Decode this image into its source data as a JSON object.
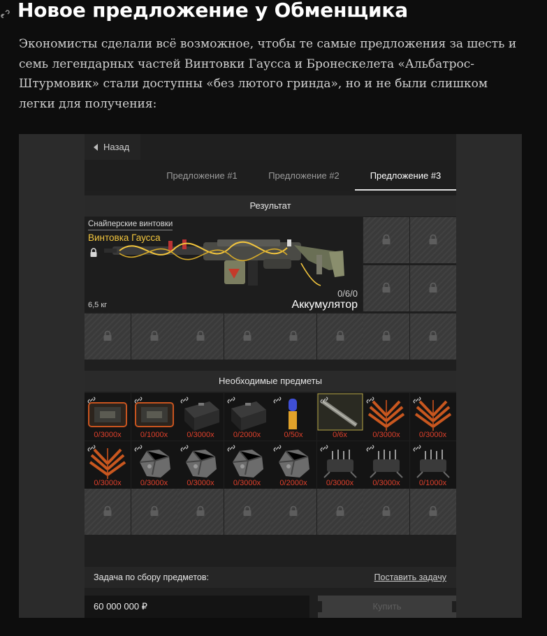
{
  "article": {
    "heading": "Новое предложение у Обменщика",
    "paragraph": "Экономисты сделали всё возможное, чтобы те самые предложения за шесть и семь легендарных частей Винтовки Гаусса и Бронескелета «Альбатрос-Штурмовик» стали доступны «без лютого гринда», но и не были слишком легки для получения:"
  },
  "ui": {
    "back_label": "Назад",
    "tabs": [
      {
        "label": "Предложение #1",
        "active": false
      },
      {
        "label": "Предложение #2",
        "active": false
      },
      {
        "label": "Предложение #3",
        "active": true
      }
    ],
    "result_title": "Результат",
    "weapon": {
      "category": "Снайперские винтовки",
      "name": "Винтовка Гаусса",
      "weight": "6,5 кг",
      "ammo_count": "0/6/0",
      "ammo_type": "Аккумулятор"
    },
    "required_title": "Необходимые предметы",
    "required_items": [
      {
        "qty": "0/3000x",
        "icon": "crate-icon"
      },
      {
        "qty": "0/1000x",
        "icon": "crate-icon"
      },
      {
        "qty": "0/3000x",
        "icon": "battery-icon"
      },
      {
        "qty": "0/2000x",
        "icon": "battery-icon"
      },
      {
        "qty": "0/50x",
        "icon": "cartridge-icon"
      },
      {
        "qty": "0/6x",
        "icon": "rifle-part-icon"
      },
      {
        "qty": "0/3000x",
        "icon": "fern-icon"
      },
      {
        "qty": "0/3000x",
        "icon": "fern-icon"
      },
      {
        "qty": "0/3000x",
        "icon": "fern-icon"
      },
      {
        "qty": "0/3000x",
        "icon": "ore-icon"
      },
      {
        "qty": "0/3000x",
        "icon": "ore-icon"
      },
      {
        "qty": "0/3000x",
        "icon": "ore-icon"
      },
      {
        "qty": "0/2000x",
        "icon": "ore-icon"
      },
      {
        "qty": "0/3000x",
        "icon": "wire-bundle-icon"
      },
      {
        "qty": "0/3000x",
        "icon": "wire-bundle-icon"
      },
      {
        "qty": "0/1000x",
        "icon": "wire-bundle-icon"
      }
    ],
    "task_label": "Задача по сбору предметов:",
    "task_link": "Поставить задачу",
    "price": "60 000 000 ₽",
    "buy_label": "Купить",
    "colors": {
      "accent_yellow": "#f3c63e",
      "qty_red": "#e0402b"
    }
  }
}
